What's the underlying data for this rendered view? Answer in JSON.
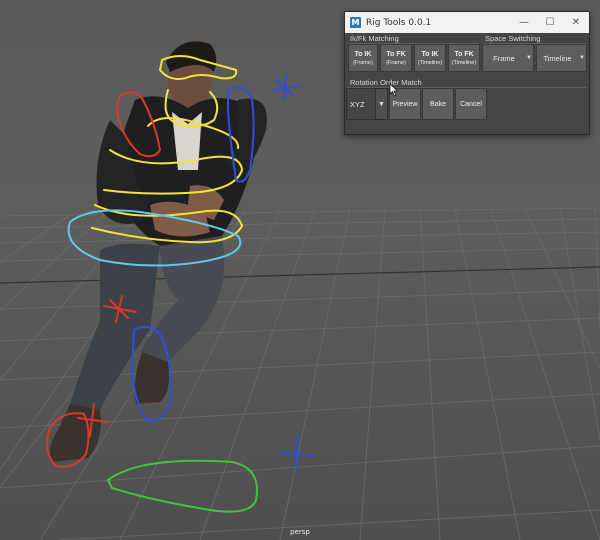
{
  "viewport": {
    "camera_label": "persp"
  },
  "window": {
    "title": "Rig Tools 0.0.1",
    "icon_letter": "M",
    "controls": {
      "minimize": "—",
      "maximize": "☐",
      "close": "✕"
    }
  },
  "ikfk": {
    "label": "Ik/Fk Matching",
    "buttons": [
      {
        "main": "To IK",
        "sub": "(Frame)"
      },
      {
        "main": "To FK",
        "sub": "(Frame)"
      },
      {
        "main": "To IK",
        "sub": "(Timeline)"
      },
      {
        "main": "To FK",
        "sub": "(Timeline)"
      }
    ]
  },
  "space_switching": {
    "label": "Space Switching",
    "frame": "Frame",
    "timeline": "Timeline"
  },
  "rotation_order": {
    "label": "Rotation Order Match",
    "value": "XYZ",
    "preview": "Preview",
    "bake": "Bake",
    "cancel": "Cancel"
  },
  "colors": {
    "window_bg": "#444444",
    "button_bg": "#5d5d5d",
    "titlebar_bg": "#f2f2f2",
    "ctrl_yellow": "#f2e23a",
    "ctrl_red": "#d83a2a",
    "ctrl_blue": "#2f4fd8",
    "ctrl_cyan": "#5fc8e6",
    "ctrl_green": "#3fc23f"
  }
}
